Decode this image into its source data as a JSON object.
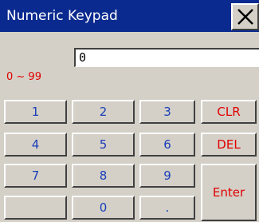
{
  "window": {
    "title": "Numeric Keypad",
    "close_icon": "close-icon"
  },
  "display": {
    "value": "0"
  },
  "range": {
    "text": "0 ~ 99"
  },
  "keys": {
    "k1": "1",
    "k2": "2",
    "k3": "3",
    "k4": "4",
    "k5": "5",
    "k6": "6",
    "k7": "7",
    "k8": "8",
    "k9": "9",
    "k0": "0",
    "dot": ".",
    "blank": "",
    "clr": "CLR",
    "del": "DEL",
    "enter": "Enter"
  },
  "colors": {
    "titlebar": "#0a2a8f",
    "digit_text": "#1a3fb8",
    "function_text": "#e00000",
    "face": "#d4d0c8"
  }
}
